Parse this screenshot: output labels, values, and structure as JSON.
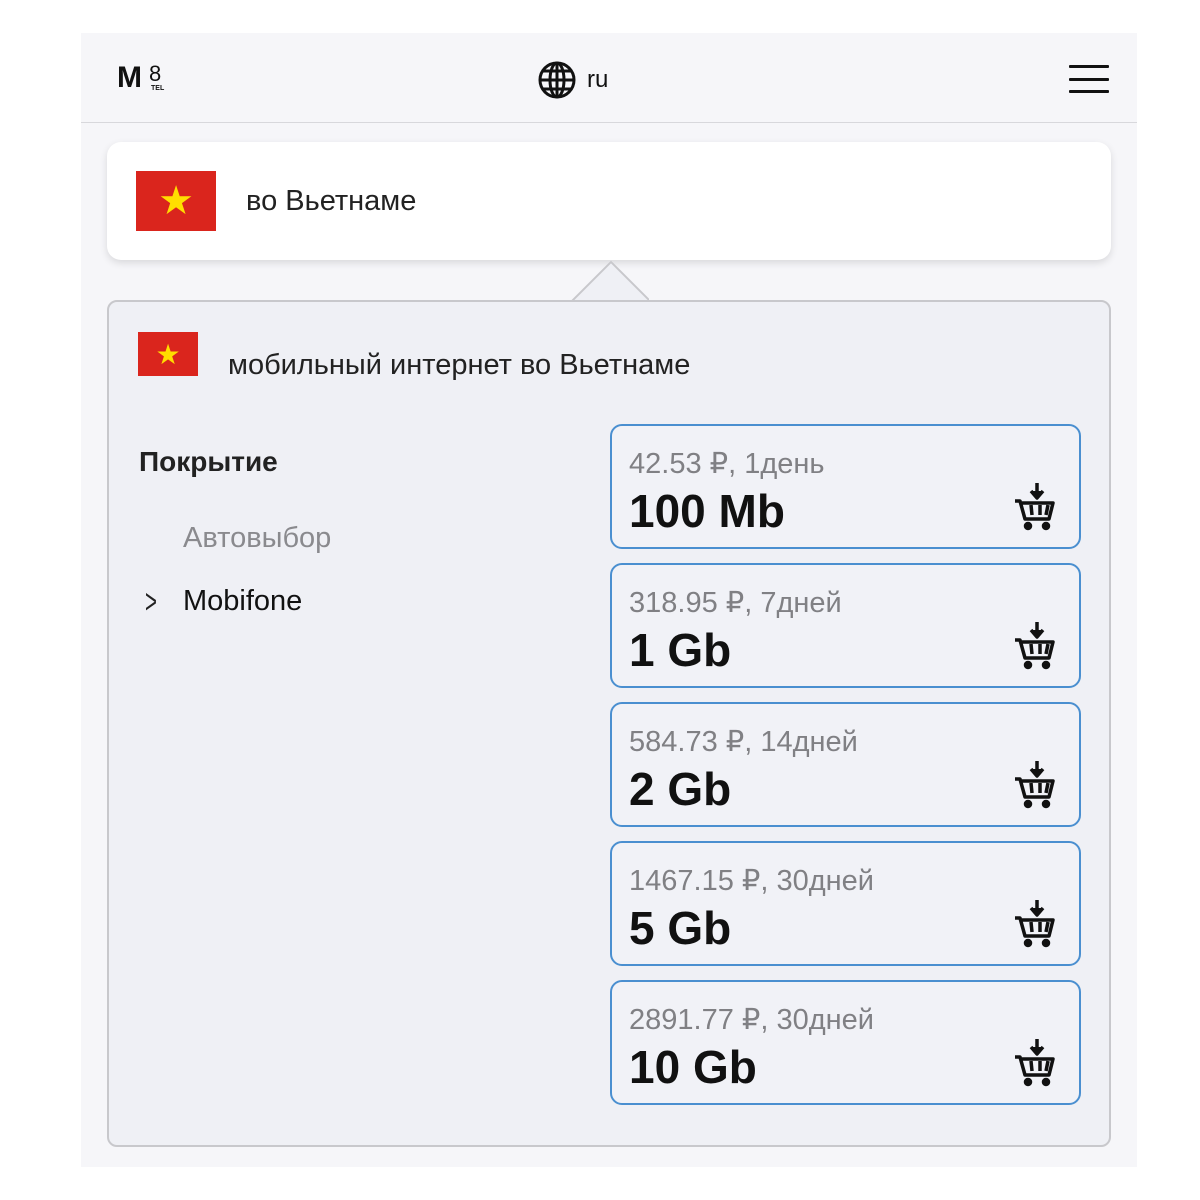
{
  "header": {
    "logo": "M8",
    "logo_sub": "TEL",
    "language": "ru"
  },
  "country": {
    "name": "во Вьетнаме",
    "flag": "vietnam-flag"
  },
  "panel": {
    "title": "мобильный интернет во Вьетнаме",
    "coverage_label": "Покрытие",
    "operators": [
      "Автовыбор",
      "Mobifone"
    ]
  },
  "plans": [
    {
      "price": "42.53 ₽, 1день",
      "volume": "100 Mb"
    },
    {
      "price": "318.95 ₽, 7дней",
      "volume": "1 Gb"
    },
    {
      "price": "584.73 ₽, 14дней",
      "volume": "2 Gb"
    },
    {
      "price": "1467.15 ₽, 30дней",
      "volume": "5 Gb"
    },
    {
      "price": "2891.77 ₽, 30дней",
      "volume": "10 Gb"
    }
  ],
  "colors": {
    "accent": "#4a8fd0",
    "flag_red": "#da251d",
    "flag_star": "#ffde00"
  }
}
